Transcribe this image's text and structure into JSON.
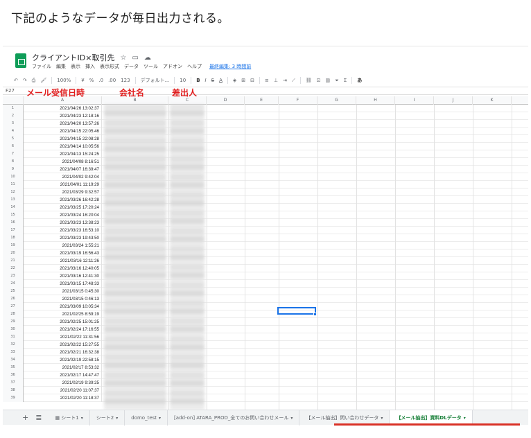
{
  "heading": "下記のようなデータが毎日出力される。",
  "app": {
    "title": "クライアントID×取引先",
    "title_icons": [
      "star-icon",
      "folder-icon",
      "cloud-icon"
    ],
    "menu": [
      "ファイル",
      "編集",
      "表示",
      "挿入",
      "表示形式",
      "データ",
      "ツール",
      "アドオン",
      "ヘルプ"
    ],
    "last_edit": "最終編集: 3 時間前"
  },
  "toolbar": {
    "zoom": "100%",
    "currency": "¥",
    "percent": "%",
    "decimal_less": ".0",
    "decimal_more": ".00",
    "number_format": "123",
    "font": "デフォルト...",
    "font_size": "10",
    "bold": "B",
    "italic": "I",
    "strike": "S",
    "text_color": "A",
    "ime": "あ"
  },
  "formula_bar": {
    "cell_ref": "F27"
  },
  "columns": [
    "A",
    "B",
    "C",
    "D",
    "E",
    "F",
    "G",
    "H",
    "I",
    "J",
    "K"
  ],
  "annotations": {
    "col_a": "メール受信日時",
    "col_b": "会社名",
    "col_c": "差出人",
    "color": "#e01e1e"
  },
  "rows": [
    {
      "n": "1",
      "date": "2021/04/26 13:02:37"
    },
    {
      "n": "2",
      "date": "2021/04/23 12:18:16"
    },
    {
      "n": "3",
      "date": "2021/04/20 13:57:26"
    },
    {
      "n": "4",
      "date": "2021/04/15 22:05:46"
    },
    {
      "n": "5",
      "date": "2021/04/15 22:08:28"
    },
    {
      "n": "6",
      "date": "2021/04/14 10:05:56"
    },
    {
      "n": "7",
      "date": "2021/04/13 15:24:25"
    },
    {
      "n": "8",
      "date": "2021/04/08 8:16:51"
    },
    {
      "n": "9",
      "date": "2021/04/07 16:39:47"
    },
    {
      "n": "10",
      "date": "2021/04/02 9:42:04"
    },
    {
      "n": "11",
      "date": "2021/04/01 11:19:29"
    },
    {
      "n": "12",
      "date": "2021/03/29 9:32:57"
    },
    {
      "n": "13",
      "date": "2021/03/26 16:42:28"
    },
    {
      "n": "14",
      "date": "2021/03/25 17:20:24"
    },
    {
      "n": "15",
      "date": "2021/03/24 16:20:04"
    },
    {
      "n": "16",
      "date": "2021/03/23 13:38:23"
    },
    {
      "n": "17",
      "date": "2021/03/23 16:53:10"
    },
    {
      "n": "18",
      "date": "2021/03/23 19:43:50"
    },
    {
      "n": "19",
      "date": "2021/03/24 1:55:21"
    },
    {
      "n": "20",
      "date": "2021/03/19 16:56:43"
    },
    {
      "n": "21",
      "date": "2021/03/16 12:11:26"
    },
    {
      "n": "22",
      "date": "2021/03/16 12:40:05"
    },
    {
      "n": "23",
      "date": "2021/03/16 12:41:30"
    },
    {
      "n": "24",
      "date": "2021/03/15 17:48:33"
    },
    {
      "n": "25",
      "date": "2021/03/15 0:45:30"
    },
    {
      "n": "26",
      "date": "2021/03/15 0:46:13"
    },
    {
      "n": "27",
      "date": "2021/03/09 10:05:34"
    },
    {
      "n": "28",
      "date": "2021/02/25 8:59:19"
    },
    {
      "n": "29",
      "date": "2021/02/25 15:01:25"
    },
    {
      "n": "30",
      "date": "2021/02/24 17:16:55"
    },
    {
      "n": "31",
      "date": "2021/02/22 11:31:56"
    },
    {
      "n": "32",
      "date": "2021/02/22 15:27:55"
    },
    {
      "n": "33",
      "date": "2021/02/21 16:32:38"
    },
    {
      "n": "34",
      "date": "2021/02/19 22:58:15"
    },
    {
      "n": "35",
      "date": "2021/02/17 8:53:32"
    },
    {
      "n": "36",
      "date": "2021/02/17 14:47:47"
    },
    {
      "n": "37",
      "date": "2021/02/19 9:39:25"
    },
    {
      "n": "38",
      "date": "2021/02/20 11:07:37"
    },
    {
      "n": "39",
      "date": "2021/02/20 11:18:37"
    }
  ],
  "tabs": [
    {
      "label": "シート1",
      "icon": "grid-icon"
    },
    {
      "label": "シート2"
    },
    {
      "label": "domo_test"
    },
    {
      "label": "[add-on] ATARA_PROD_全てのお問い合わせメール"
    },
    {
      "label": "【メール抽出】問い合わせデータ"
    },
    {
      "label": "【メール抽出】資料DLデータ",
      "active": true
    }
  ],
  "tab_arrow": "▾",
  "colors": {
    "sheets_green": "#0f9d58",
    "selection": "#1a73e8",
    "active_tab": "#188038",
    "tab_underline": "#d93025"
  }
}
